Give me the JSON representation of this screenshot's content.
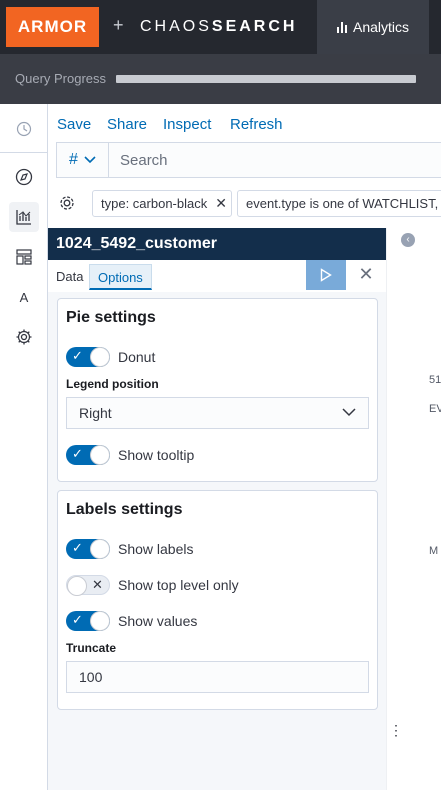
{
  "header": {
    "brand": "ARMOR",
    "plus": "+",
    "partner_light": "CHAOS",
    "partner_bold": "SEARCH",
    "active_tab": "Analytics"
  },
  "query_progress": {
    "label": "Query Progress"
  },
  "sidebar": {
    "items": [
      {
        "name": "history-icon"
      },
      {
        "name": "discover-icon"
      },
      {
        "name": "visualize-icon"
      },
      {
        "name": "dashboard-icon"
      },
      {
        "name": "alerts-icon",
        "glyph": "A"
      },
      {
        "name": "settings-icon"
      }
    ]
  },
  "toolbar": {
    "save": "Save",
    "share": "Share",
    "inspect": "Inspect",
    "refresh": "Refresh"
  },
  "query": {
    "language_symbol": "#",
    "search_placeholder": "Search"
  },
  "filters": [
    {
      "label": "type: carbon-black"
    },
    {
      "label": "event.type is one of WATCHLIST, C"
    }
  ],
  "editor": {
    "title": "1024_5492_customer",
    "tabs": [
      {
        "label": "Data"
      },
      {
        "label": "Options"
      }
    ],
    "pie_settings": {
      "heading": "Pie settings",
      "donut_label": "Donut",
      "donut_on": true,
      "legend_position_label": "Legend position",
      "legend_position_value": "Right",
      "show_tooltip_label": "Show tooltip",
      "show_tooltip_on": true
    },
    "labels_settings": {
      "heading": "Labels settings",
      "show_labels_label": "Show labels",
      "show_labels_on": true,
      "show_top_level_label": "Show top level only",
      "show_top_level_on": false,
      "show_values_label": "Show values",
      "show_values_on": true,
      "truncate_label": "Truncate",
      "truncate_value": "100"
    }
  },
  "right_panel": {
    "texts": [
      "51",
      "EV",
      "M"
    ]
  },
  "colors": {
    "brand": "#f26522",
    "header_bg": "#25282f",
    "accent": "#006bb4",
    "panel_title_bg": "#132e4b"
  }
}
